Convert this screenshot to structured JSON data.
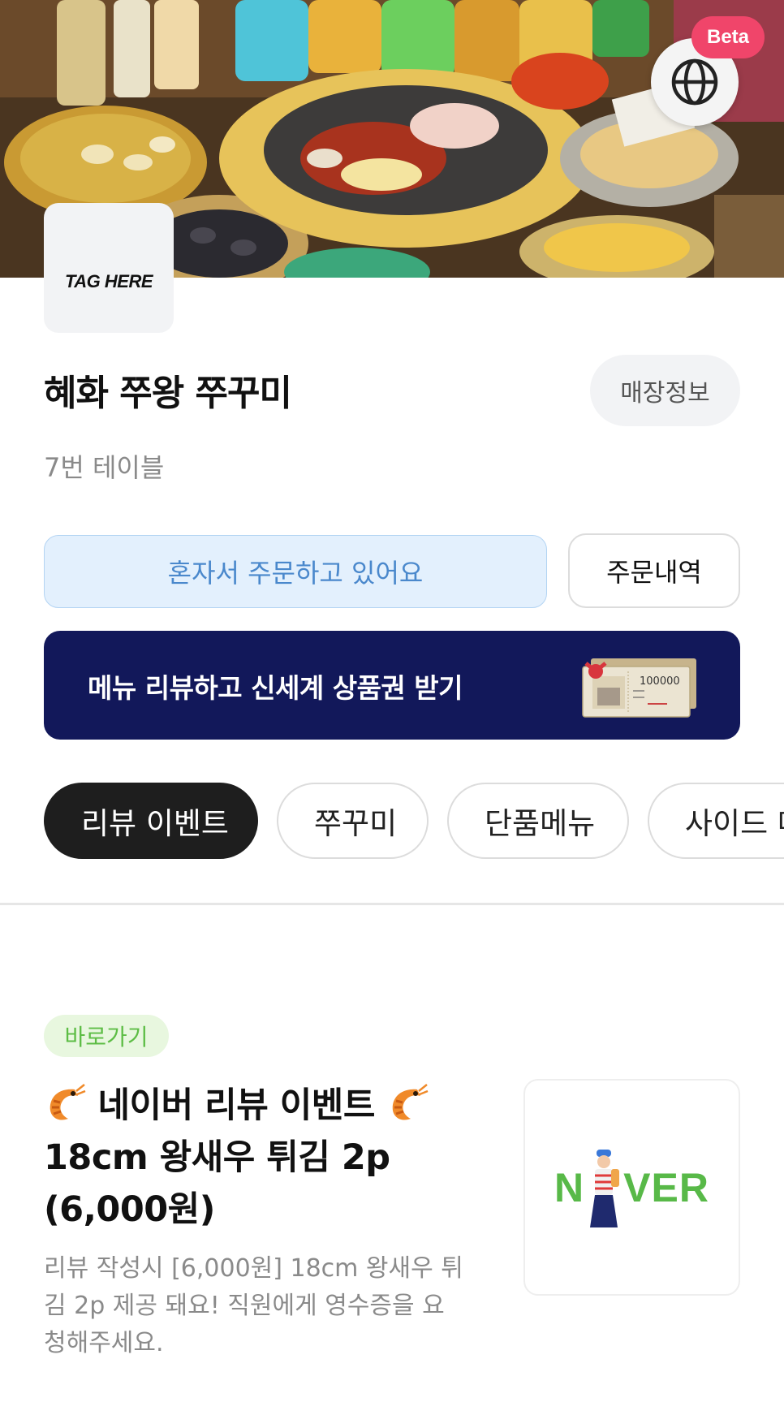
{
  "hero": {
    "beta_label": "Beta",
    "lang_icon": "globe-icon"
  },
  "store": {
    "logo_text": "TAG HERE",
    "name": "혜화 쭈왕 쭈꾸미",
    "info_button": "매장정보",
    "table": "7번 테이블"
  },
  "order": {
    "mode_label": "혼자서 주문하고 있어요",
    "history_button": "주문내역"
  },
  "banner": {
    "text": "메뉴 리뷰하고 신세계 상품권 받기",
    "voucher_amount": "100000",
    "background": "#12185a"
  },
  "tabs": [
    {
      "label": "리뷰 이벤트",
      "active": true
    },
    {
      "label": "쭈꾸미",
      "active": false
    },
    {
      "label": "단품메뉴",
      "active": false
    },
    {
      "label": "사이드 메뉴",
      "active": false
    }
  ],
  "item": {
    "badge": "바로가기",
    "title_line1": "네이버 리뷰 이벤트",
    "title_line2": "18cm 왕새우 튀김 2p",
    "title_line3": "(6,000원)",
    "description": "리뷰 작성시 [6,000원] 18cm 왕새우 튀김 2p 제공 돼요! 직원에게 영수증을 요청해주세요.",
    "thumb_text_left": "N",
    "thumb_text_right": "VER",
    "title_icon": "shrimp-icon"
  },
  "colors": {
    "accent_blue": "#4a88cc",
    "beta": "#f0456a",
    "naver_green": "#58b948"
  }
}
